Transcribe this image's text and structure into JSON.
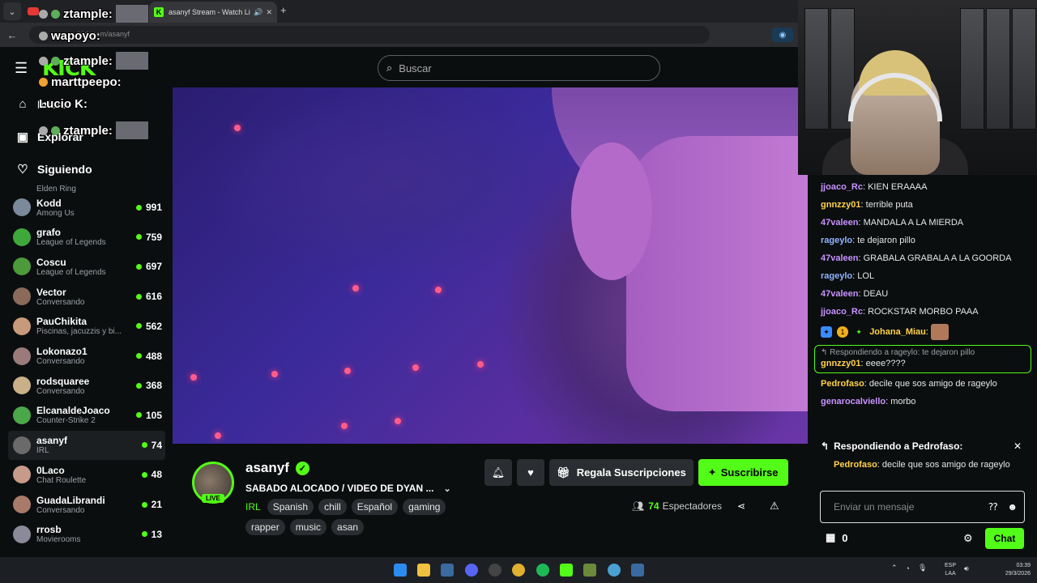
{
  "browser": {
    "tab_title": "asanyf Stream - Watch Live",
    "url": "kick.com/asanyf"
  },
  "header": {
    "logo": "KICK",
    "search_placeholder": "Buscar"
  },
  "sidebar": {
    "nav": [
      {
        "label": "Inicio",
        "icon": "home-icon"
      },
      {
        "label": "Explorar",
        "icon": "explore-icon"
      },
      {
        "label": "Siguiendo",
        "icon": "heart-icon"
      }
    ],
    "partial_category": "Elden Ring",
    "channels": [
      {
        "name": "Kodd",
        "category": "Among Us",
        "viewers": "991",
        "color": "#7a8a9a"
      },
      {
        "name": "grafo",
        "category": "League of Legends",
        "viewers": "759",
        "color": "#3fa83a"
      },
      {
        "name": "Coscu",
        "category": "League of Legends",
        "viewers": "697",
        "color": "#4c9a3a"
      },
      {
        "name": "Vector",
        "category": "Conversando",
        "viewers": "616",
        "color": "#8a6a5a"
      },
      {
        "name": "PauChikita",
        "category": "Piscinas, jacuzzis y bi...",
        "viewers": "562",
        "color": "#c69a7a"
      },
      {
        "name": "Lokonazo1",
        "category": "Conversando",
        "viewers": "488",
        "color": "#9a7a7a"
      },
      {
        "name": "rodsquaree",
        "category": "Conversando",
        "viewers": "368",
        "color": "#c8b088"
      },
      {
        "name": "ElcanaldeJoaco",
        "category": "Counter-Strike 2",
        "viewers": "105",
        "color": "#4aa848"
      },
      {
        "name": "asanyf",
        "category": "IRL",
        "viewers": "74",
        "color": "#6a6a6a"
      },
      {
        "name": "0Laco",
        "category": "Chat Roulette",
        "viewers": "48",
        "color": "#c89a8a"
      },
      {
        "name": "GuadaLibrandi",
        "category": "Conversando",
        "viewers": "21",
        "color": "#a87a6a"
      },
      {
        "name": "rrosb",
        "category": "Movierooms",
        "viewers": "13",
        "color": "#8a8a9a"
      }
    ]
  },
  "stream": {
    "name": "asanyf",
    "title": "SABADO ALOCADO / VIDEO DE DYAN ...",
    "category": "IRL",
    "tags": [
      "Spanish",
      "chill",
      "Español",
      "gaming",
      "rapper",
      "music",
      "asan"
    ],
    "live_label": "LIVE",
    "viewers": "74",
    "viewers_label": "Espectadores",
    "gift_label": "Regala Suscripciones",
    "subscribe_label": "Suscribirse"
  },
  "overlay": [
    {
      "text": "ztample:"
    },
    {
      "text": "wapoyo:"
    },
    {
      "text": "ztample:"
    },
    {
      "text": "marttpeepo:"
    },
    {
      "text": "Lucio K:"
    },
    {
      "text": "ztample:"
    }
  ],
  "chat": {
    "messages": [
      {
        "user": "jjoaco_Rc",
        "color": "#c792ff",
        "text": "KIEN ERAAAA"
      },
      {
        "user": "gnnzzy01",
        "color": "#ffd24a",
        "text": "terrible puta"
      },
      {
        "user": "47valeen",
        "color": "#c792ff",
        "text": "MANDALA A LA MIERDA"
      },
      {
        "user": "rageylo",
        "color": "#8fb4ff",
        "text": "te dejaron pillo"
      },
      {
        "user": "47valeen",
        "color": "#c792ff",
        "text": "GRABALA GRABALA A LA GOORDA"
      },
      {
        "user": "rageylo",
        "color": "#8fb4ff",
        "text": "LOL"
      },
      {
        "user": "47valeen",
        "color": "#c792ff",
        "text": "DEAU"
      },
      {
        "user": "jjoaco_Rc",
        "color": "#c792ff",
        "text": "ROCKSTAR MORBO PAAA"
      }
    ],
    "badge_msg": {
      "user": "Johana_Miau",
      "color": "#ffd24a"
    },
    "reply_msg": {
      "reply_to": "Respondiendo a rageylo: te dejaron pillo",
      "user": "gnnzzy01",
      "color": "#ffd24a",
      "text": "eeee????"
    },
    "after": [
      {
        "user": "Pedrofaso",
        "color": "#ffd24a",
        "text": "decile que sos amigo de rageylo"
      },
      {
        "user": "genarocalviello",
        "color": "#c792ff",
        "text": "morbo"
      }
    ],
    "replying_header": "Respondiendo a Pedrofaso:",
    "replying_user": "Pedrofaso",
    "replying_text": "decile que sos amigo de rageylo",
    "input_placeholder": "Enviar un mensaje",
    "points": "0",
    "chat_button": "Chat"
  },
  "taskbar": {
    "lang": "ESP",
    "lang2": "LAA",
    "time": "03:39",
    "date": "29/3/2026"
  }
}
